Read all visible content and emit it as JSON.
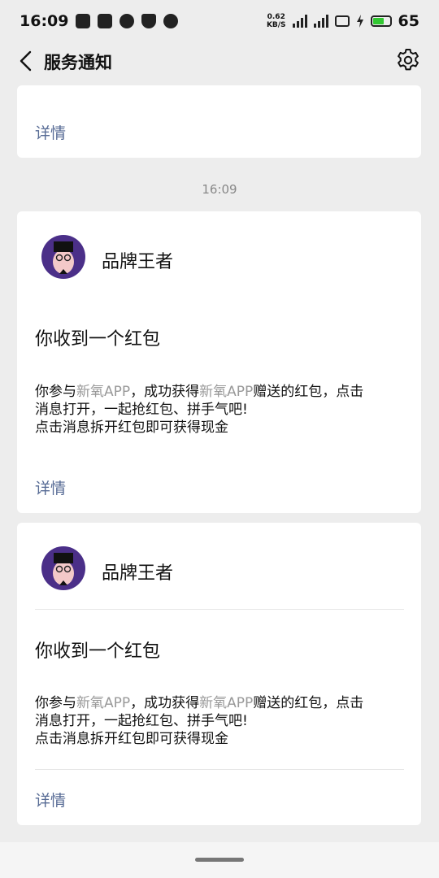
{
  "status_bar": {
    "time": "16:09",
    "net_speed_value": "0.62",
    "net_speed_unit": "KB/S",
    "battery_level": "65",
    "icons": [
      "notification-icon",
      "hash-icon",
      "chat-icon",
      "shield-icon",
      "sos-icon",
      "signal-4g-icon",
      "signal-4g2-icon",
      "hd-icon",
      "charging-icon",
      "battery-icon"
    ]
  },
  "header": {
    "title": "服务通知",
    "back_icon": "chevron-left-icon",
    "settings_icon": "gear-icon"
  },
  "cards": [
    {
      "detail_label": "详情"
    },
    {
      "sender": "品牌王者",
      "message_title": "你收到一个红包",
      "line1_a": "你参与",
      "line1_app": "新氧APP",
      "line1_b": "，成功获得",
      "line1_app2": "新氧APP",
      "line1_c": "赠送的红包，点击",
      "line2": "消息打开，一起抢红包、拼手气吧!",
      "line3": "点击消息拆开红包即可获得现金",
      "detail_label": "详情"
    },
    {
      "sender": "品牌王者",
      "message_title": "你收到一个红包",
      "line1_a": "你参与",
      "line1_app": "新氧APP",
      "line1_b": "，成功获得",
      "line1_app2": "新氧APP",
      "line1_c": "赠送的红包，点击",
      "line2": "消息打开，一起抢红包、拼手气吧!",
      "line3": "点击消息拆开红包即可获得现金",
      "detail_label": "详情"
    }
  ],
  "timestamp": "16:09",
  "colors": {
    "link": "#576b95",
    "muted": "#999999",
    "background": "#ededed",
    "battery": "#32c832"
  }
}
